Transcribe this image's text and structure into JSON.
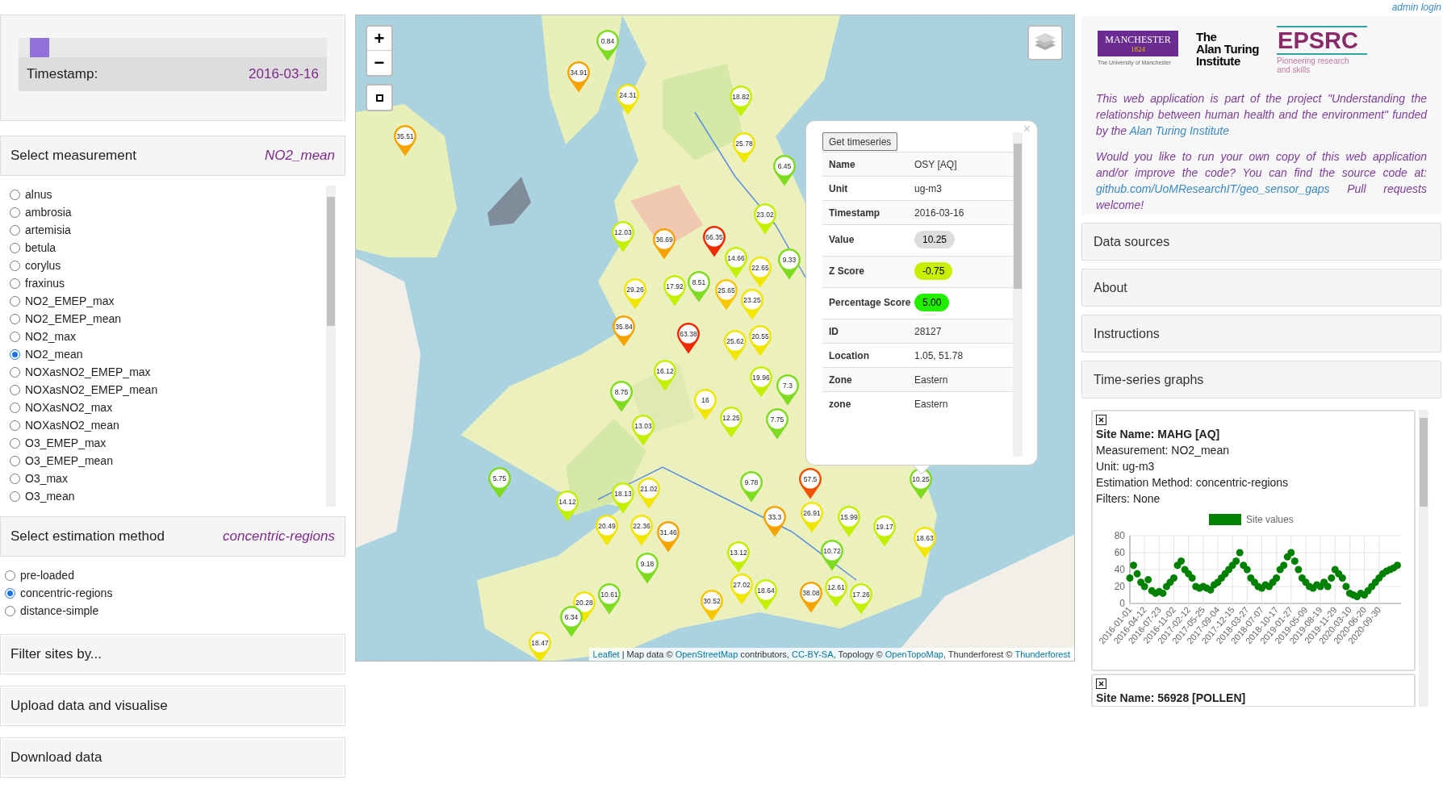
{
  "admin_link": "admin login",
  "timeline": {
    "level": 0.04,
    "label": "Timestamp:",
    "value": "2016-03-16"
  },
  "measurement": {
    "title": "Select measurement",
    "current": "NO2_mean",
    "options": [
      {
        "label": "alnus",
        "selected": false
      },
      {
        "label": "ambrosia",
        "selected": false
      },
      {
        "label": "artemisia",
        "selected": false
      },
      {
        "label": "betula",
        "selected": false
      },
      {
        "label": "corylus",
        "selected": false
      },
      {
        "label": "fraxinus",
        "selected": false
      },
      {
        "label": "NO2_EMEP_max",
        "selected": false
      },
      {
        "label": "NO2_EMEP_mean",
        "selected": false
      },
      {
        "label": "NO2_max",
        "selected": false
      },
      {
        "label": "NO2_mean",
        "selected": true
      },
      {
        "label": "NOXasNO2_EMEP_max",
        "selected": false
      },
      {
        "label": "NOXasNO2_EMEP_mean",
        "selected": false
      },
      {
        "label": "NOXasNO2_max",
        "selected": false
      },
      {
        "label": "NOXasNO2_mean",
        "selected": false
      },
      {
        "label": "O3_EMEP_max",
        "selected": false
      },
      {
        "label": "O3_EMEP_mean",
        "selected": false
      },
      {
        "label": "O3_max",
        "selected": false
      },
      {
        "label": "O3_mean",
        "selected": false
      }
    ]
  },
  "estimation": {
    "title": "Select estimation method",
    "current": "concentric-regions",
    "options": [
      {
        "label": "pre-loaded",
        "selected": false
      },
      {
        "label": "concentric-regions",
        "selected": true
      },
      {
        "label": "distance-simple",
        "selected": false
      }
    ]
  },
  "panels": [
    "Filter sites by...",
    "Upload data and visualise",
    "Download data"
  ],
  "map": {
    "zoom_in": "+",
    "zoom_out": "−",
    "markers": [
      {
        "value": "0.84",
        "color": "#7ddc1f"
      },
      {
        "value": "34.91",
        "color": "#f5a300"
      },
      {
        "value": "24.31",
        "color": "#f0e600"
      },
      {
        "value": "35.51",
        "color": "#f5a300"
      },
      {
        "value": "12.03",
        "color": "#c2f000"
      },
      {
        "value": "36.69",
        "color": "#f5a300"
      },
      {
        "value": "29.26",
        "color": "#f0e600"
      },
      {
        "value": "17.92",
        "color": "#c2f000"
      },
      {
        "value": "35.84",
        "color": "#f5a300"
      },
      {
        "value": "63.38",
        "color": "#f02a00"
      },
      {
        "value": "18.82",
        "color": "#c2f000"
      },
      {
        "value": "25.78",
        "color": "#f0e600"
      },
      {
        "value": "6.45",
        "color": "#7ddc1f"
      },
      {
        "value": "23.02",
        "color": "#c2f000"
      },
      {
        "value": "14.66",
        "color": "#c2f000"
      },
      {
        "value": "22.65",
        "color": "#f0e600"
      },
      {
        "value": "9.33",
        "color": "#7ddc1f"
      },
      {
        "value": "25.65",
        "color": "#f7c600"
      },
      {
        "value": "23.25",
        "color": "#f0e600"
      },
      {
        "value": "66.35",
        "color": "#f02a00"
      },
      {
        "value": "16.12",
        "color": "#c2f000"
      },
      {
        "value": "8.75",
        "color": "#7ddc1f"
      },
      {
        "value": "13.03",
        "color": "#c2f000"
      },
      {
        "value": "5.75",
        "color": "#7ddc1f"
      },
      {
        "value": "14.12",
        "color": "#c2f000"
      },
      {
        "value": "18.13",
        "color": "#c2f000"
      },
      {
        "value": "21.02",
        "color": "#f0e600"
      },
      {
        "value": "20.49",
        "color": "#f0e600"
      },
      {
        "value": "22.36",
        "color": "#f0e600"
      },
      {
        "value": "31.46",
        "color": "#f5a300"
      },
      {
        "value": "9.18",
        "color": "#7ddc1f"
      },
      {
        "value": "10.61",
        "color": "#7ddc1f"
      },
      {
        "value": "20.28",
        "color": "#f0e600"
      },
      {
        "value": "6.34",
        "color": "#7ddc1f"
      },
      {
        "value": "18.47",
        "color": "#f0e600"
      },
      {
        "value": "16",
        "color": "#f0e600"
      },
      {
        "value": "19.96",
        "color": "#c2f000"
      },
      {
        "value": "7.3",
        "color": "#7ddc1f"
      },
      {
        "value": "12.25",
        "color": "#c2f000"
      },
      {
        "value": "7.75",
        "color": "#7ddc1f"
      },
      {
        "value": "57.5",
        "color": "#f05000"
      },
      {
        "value": "9.78",
        "color": "#7ddc1f"
      },
      {
        "value": "10.25",
        "color": "#7ddc1f"
      },
      {
        "value": "33.3",
        "color": "#f5a300"
      },
      {
        "value": "26.91",
        "color": "#f0e600"
      },
      {
        "value": "15.99",
        "color": "#c2f000"
      },
      {
        "value": "19.17",
        "color": "#c2f000"
      },
      {
        "value": "18.63",
        "color": "#f0e600"
      },
      {
        "value": "10.72",
        "color": "#7ddc1f"
      },
      {
        "value": "13.12",
        "color": "#c2f000"
      },
      {
        "value": "27.02",
        "color": "#f0e600"
      },
      {
        "value": "18.64",
        "color": "#c2f000"
      },
      {
        "value": "38.08",
        "color": "#f5a300"
      },
      {
        "value": "12.61",
        "color": "#c2f000"
      },
      {
        "value": "17.26",
        "color": "#c2f000"
      },
      {
        "value": "25.62",
        "color": "#f0e600"
      },
      {
        "value": "20.55",
        "color": "#f0e600"
      },
      {
        "value": "8.51",
        "color": "#7ddc1f"
      },
      {
        "value": "30.52",
        "color": "#f7c600"
      }
    ],
    "popup": {
      "button": "Get timeseries",
      "close": "×",
      "rows": [
        {
          "label": "Name",
          "value": "OSY [AQ]",
          "kind": "plain"
        },
        {
          "label": "Unit",
          "value": "ug-m3",
          "kind": "plain"
        },
        {
          "label": "Timestamp",
          "value": "2016-03-16",
          "kind": "plain"
        },
        {
          "label": "Value",
          "value": "10.25",
          "kind": "badge",
          "color": "#dddddd"
        },
        {
          "label": "Z Score",
          "value": "-0.75",
          "kind": "badge",
          "color": "#c6f000"
        },
        {
          "label": "Percentage Score",
          "value": "5.00",
          "kind": "badge",
          "color": "#22ee00"
        },
        {
          "label": "ID",
          "value": "28127",
          "kind": "plain"
        },
        {
          "label": "Location",
          "value": "1.05, 51.78",
          "kind": "plain"
        },
        {
          "label": "Zone",
          "value": "Eastern",
          "kind": "plain"
        },
        {
          "label": "zone",
          "value": "Eastern",
          "kind": "plain"
        }
      ]
    },
    "attribution": [
      {
        "text": "Leaflet",
        "kind": "link"
      },
      {
        "text": " | Map data © ",
        "kind": "plain"
      },
      {
        "text": "OpenStreetMap",
        "kind": "link"
      },
      {
        "text": " contributors, ",
        "kind": "plain"
      },
      {
        "text": "CC-BY-SA",
        "kind": "link"
      },
      {
        "text": ", Topology © ",
        "kind": "plain"
      },
      {
        "text": "OpenTopoMap",
        "kind": "link"
      },
      {
        "text": ", Thunderforest © ",
        "kind": "plain"
      },
      {
        "text": "Thunderforest",
        "kind": "link"
      }
    ]
  },
  "logos": {
    "manchester": {
      "name": "MANCHESTER",
      "year": "1824",
      "subtitle": "The University of Manchester"
    },
    "turing": [
      "The",
      "Alan Turing",
      "Institute"
    ],
    "epsrc": {
      "name": "EPSRC",
      "tagline": "Pioneering research and skills"
    }
  },
  "info": [
    [
      {
        "text": "This web application is part of the project \"Understanding the relationship between human health and the environment\" funded by the ",
        "kind": "plain"
      },
      {
        "text": "Alan Turing Institute",
        "kind": "link"
      }
    ],
    [
      {
        "text": "Would you like to run your own copy of this web application and/or improve the code? You can find the source code at: ",
        "kind": "plain"
      },
      {
        "text": "github.com/UoMResearchIT/geo_sensor_gaps",
        "kind": "link"
      },
      {
        "text": " Pull requests welcome!",
        "kind": "plain"
      }
    ]
  ],
  "sections": [
    "Data sources",
    "About",
    "Instructions",
    "Time-series graphs"
  ],
  "graphs": [
    {
      "title": "Site Name: MAHG [AQ]",
      "lines": [
        "Measurement: NO2_mean",
        "Unit: ug-m3",
        "Estimation Method: concentric-regions",
        "Filters: None"
      ],
      "chart_data": {
        "type": "scatter",
        "grid": true,
        "ylim": [
          0,
          80
        ],
        "yticks": [
          0,
          20,
          40,
          60,
          80
        ],
        "categories": [
          "2016-01-01",
          null,
          null,
          null,
          "2016-04-12",
          null,
          null,
          null,
          "2016-07-23",
          null,
          null,
          null,
          "2016-11-02",
          null,
          null,
          null,
          "2017-02-12",
          null,
          null,
          null,
          "2017-05-25",
          null,
          null,
          null,
          "2017-09-04",
          null,
          null,
          null,
          "2017-12-15",
          null,
          null,
          null,
          "2018-03-27",
          null,
          null,
          null,
          "2018-07-07",
          null,
          null,
          null,
          "2018-10-17",
          null,
          null,
          null,
          "2019-01-27",
          null,
          null,
          null,
          "2019-05-09",
          null,
          null,
          null,
          "2019-08-19",
          null,
          null,
          null,
          "2019-11-29",
          null,
          null,
          null,
          "2020-03-10",
          null,
          null,
          null,
          "2020-06-20",
          null,
          null,
          null,
          "2020-09-30",
          null,
          null,
          null,
          null,
          null
        ],
        "series": [
          {
            "name": "Site values",
            "color": "#008000",
            "values": [
              30,
              45,
              35,
              25,
              20,
              28,
              15,
              12,
              14,
              12,
              20,
              25,
              30,
              45,
              50,
              40,
              35,
              30,
              20,
              18,
              20,
              18,
              16,
              22,
              25,
              30,
              35,
              40,
              45,
              50,
              60,
              45,
              40,
              30,
              25,
              20,
              18,
              22,
              20,
              25,
              30,
              40,
              45,
              55,
              60,
              50,
              40,
              30,
              25,
              20,
              18,
              22,
              20,
              25,
              20,
              30,
              40,
              35,
              30,
              20,
              12,
              10,
              8,
              12,
              10,
              15,
              20,
              25,
              30,
              35,
              38,
              40,
              42,
              45
            ]
          }
        ]
      }
    },
    {
      "title": "Site Name: 56928 [POLLEN]"
    }
  ]
}
